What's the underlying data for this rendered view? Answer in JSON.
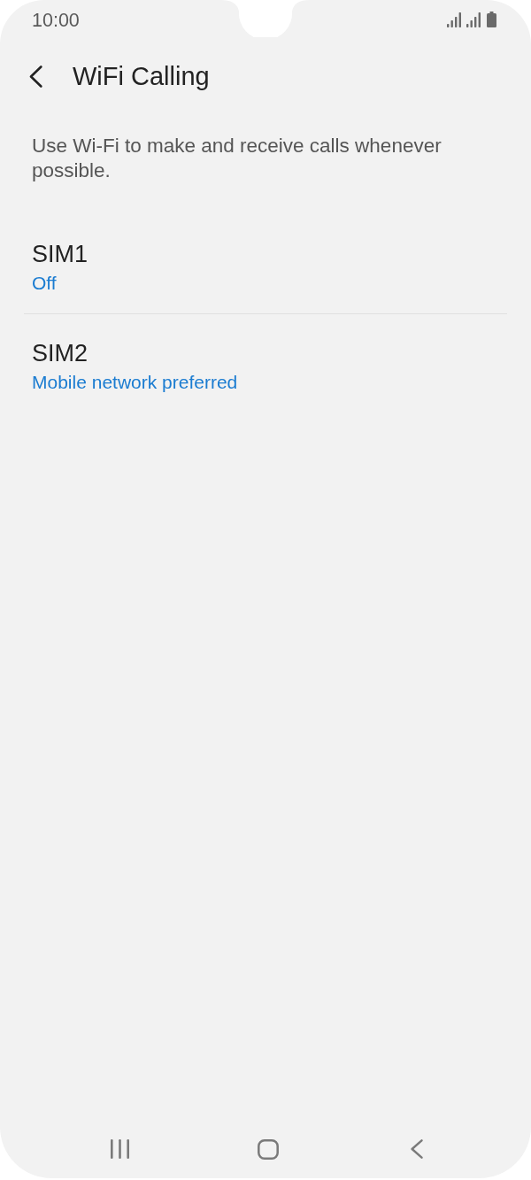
{
  "status_bar": {
    "time": "10:00"
  },
  "header": {
    "title": "WiFi Calling"
  },
  "description": "Use Wi-Fi to make and receive calls whenever possible.",
  "items": [
    {
      "title": "SIM1",
      "status": "Off"
    },
    {
      "title": "SIM2",
      "status": "Mobile network preferred"
    }
  ]
}
